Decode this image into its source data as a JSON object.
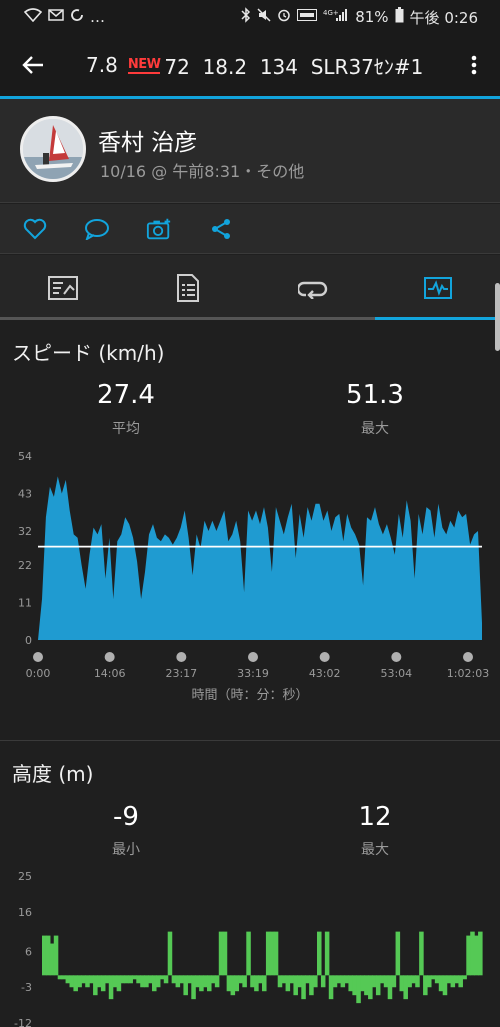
{
  "status_bar": {
    "battery": "81%",
    "time": "午後 0:26",
    "left_text": "…"
  },
  "app_bar": {
    "title_a": "7.8",
    "badge": "NEW",
    "title_b": "72  18.2  134  SLR37ｾﾝ#1"
  },
  "profile": {
    "name": "香村 治彦",
    "meta": "10/16 @ 午前8:31・その他"
  },
  "actions": [
    "heart-icon",
    "comment-icon",
    "camera-add-icon",
    "share-icon"
  ],
  "tabs": [
    {
      "name": "summary-icon",
      "active": false
    },
    {
      "name": "details-icon",
      "active": false
    },
    {
      "name": "laps-icon",
      "active": false
    },
    {
      "name": "charts-icon",
      "active": true
    }
  ],
  "speed": {
    "title": "スピード (km/h)",
    "avg_value": "27.4",
    "avg_label": "平均",
    "max_value": "51.3",
    "max_label": "最大",
    "x_axis_label": "時間（時：分：秒）"
  },
  "altitude": {
    "title": "高度 (m)",
    "min_value": "-9",
    "min_label": "最小",
    "max_value": "12",
    "max_label": "最大"
  },
  "colors": {
    "accent": "#12a4dc",
    "speed_fill": "#1f9bd1",
    "alt_fill": "#55c955",
    "avg_line": "#ffffff"
  },
  "chart_data": [
    {
      "type": "area",
      "title": "スピード (km/h)",
      "xlabel": "時間（時：分：秒）",
      "ylabel": "km/h",
      "ylim": [
        0,
        54
      ],
      "yticks": [
        0,
        11,
        22,
        32,
        43,
        54
      ],
      "xticks": [
        "0:00",
        "14:06",
        "23:17",
        "33:19",
        "43:02",
        "53:04",
        "1:02:03"
      ],
      "avg_line": 27.4,
      "series": [
        {
          "values": [
            0,
            12,
            36,
            45,
            42,
            48,
            43,
            47,
            38,
            31,
            30,
            22,
            15,
            25,
            33,
            31,
            34,
            18,
            30,
            12,
            29,
            31,
            36,
            34,
            30,
            23,
            12,
            20,
            31,
            34,
            30,
            29,
            31,
            30,
            28,
            30,
            33,
            38,
            30,
            19,
            31,
            27,
            35,
            32,
            35,
            32,
            35,
            38,
            29,
            31,
            35,
            29,
            14,
            38,
            35,
            38,
            34,
            39,
            33,
            20,
            39,
            35,
            31,
            36,
            40,
            24,
            37,
            30,
            39,
            35,
            40,
            40,
            35,
            38,
            32,
            36,
            37,
            29,
            37,
            33,
            31,
            28,
            16,
            36,
            35,
            39,
            34,
            31,
            34,
            30,
            25,
            37,
            30,
            41,
            35,
            18,
            37,
            31,
            39,
            38,
            30,
            40,
            33,
            31,
            35,
            33,
            38,
            36,
            37,
            28,
            31,
            32,
            5
          ]
        }
      ]
    },
    {
      "type": "area",
      "title": "高度 (m)",
      "ylim": [
        -12,
        25
      ],
      "yticks": [
        -12,
        -3,
        6,
        16,
        25
      ],
      "series": [
        {
          "values": [
            10,
            10,
            8,
            10,
            -1,
            -1,
            -2,
            -3,
            -4,
            -3,
            -2,
            -3,
            -2,
            -5,
            -3,
            -4,
            -2,
            -6,
            -3,
            -4,
            -2,
            -2,
            -2,
            -1,
            -2,
            -3,
            -3,
            -2,
            -4,
            -3,
            -1,
            -2,
            11,
            -2,
            -3,
            -2,
            -5,
            -2,
            -6,
            -3,
            -4,
            -3,
            -4,
            -2,
            -3,
            11,
            11,
            -4,
            -5,
            -4,
            -2,
            -3,
            11,
            -3,
            -4,
            -2,
            -4,
            11,
            11,
            11,
            -3,
            -2,
            -4,
            -2,
            -5,
            -3,
            -6,
            -2,
            -5,
            -3,
            11,
            -3,
            11,
            -6,
            -3,
            -2,
            -3,
            -2,
            -4,
            -5,
            -7,
            -4,
            -5,
            -6,
            -3,
            -5,
            -2,
            -3,
            -6,
            -3,
            11,
            -4,
            -6,
            -3,
            -2,
            -3,
            11,
            -5,
            -3,
            -1,
            -2,
            -4,
            -5,
            -2,
            -3,
            -2,
            -3,
            -1,
            10,
            11,
            10,
            11
          ]
        }
      ]
    }
  ]
}
